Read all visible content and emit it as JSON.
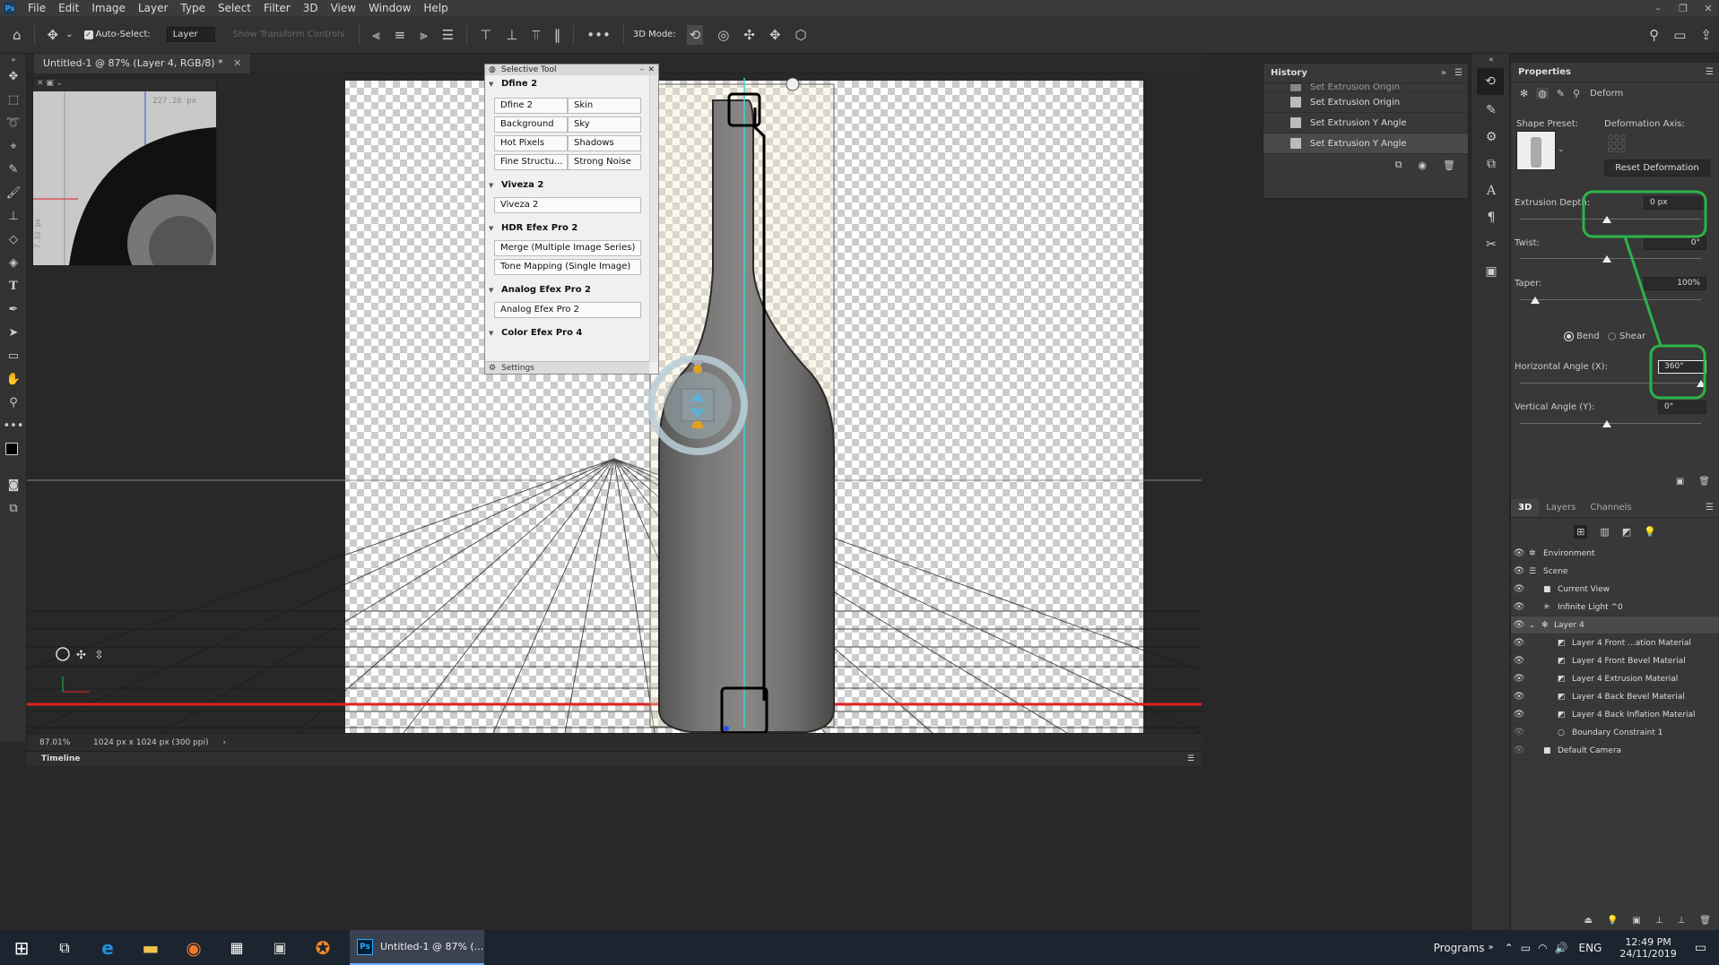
{
  "menu": [
    "File",
    "Edit",
    "Image",
    "Layer",
    "Type",
    "Select",
    "Filter",
    "3D",
    "View",
    "Window",
    "Help"
  ],
  "app_logo": "Ps",
  "options_bar": {
    "auto_select_label": "Auto-Select:",
    "auto_select_value": "Layer",
    "show_transform_label": "Show Transform Controls",
    "mode_label": "3D Mode:"
  },
  "document": {
    "tab_title": "Untitled-1 @ 87% (Layer 4, RGB/8) *",
    "zoom": "87.01%",
    "size_info": "1024 px x 1024 px (300 ppi)",
    "nav_label_top": "227.26 px",
    "nav_label_side": "7.32 px"
  },
  "timeline_label": "Timeline",
  "selective_tool": {
    "title": "Selective Tool",
    "groups": [
      {
        "name": "Dfine 2",
        "buttons": [
          "Dfine 2",
          "Skin",
          "Background",
          "Sky",
          "Hot Pixels",
          "Shadows",
          "Fine Structu...",
          "Strong Noise"
        ]
      },
      {
        "name": "Viveza 2",
        "buttons": [
          "Viveza 2"
        ]
      },
      {
        "name": "HDR Efex Pro 2",
        "buttons": [
          "Merge (Multiple Image Series)",
          "Tone Mapping (Single Image)"
        ]
      },
      {
        "name": "Analog Efex Pro 2",
        "buttons": [
          "Analog Efex Pro 2"
        ]
      },
      {
        "name": "Color Efex Pro 4",
        "buttons": []
      }
    ],
    "settings_label": "Settings"
  },
  "history": {
    "title": "History",
    "items": [
      "Set Extrusion Origin",
      "Set Extrusion Origin",
      "Set Extrusion Y Angle",
      "Set Extrusion Y Angle"
    ]
  },
  "properties": {
    "title": "Properties",
    "mode": "Deform",
    "shape_preset_label": "Shape Preset:",
    "deformation_axis_label": "Deformation Axis:",
    "reset_label": "Reset Deformation",
    "extrusion_depth_label": "Extrusion Depth:",
    "extrusion_depth_value": "0 px",
    "twist_label": "Twist:",
    "twist_value": "0°",
    "taper_label": "Taper:",
    "taper_value": "100%",
    "bend_label": "Bend",
    "shear_label": "Shear",
    "horizontal_angle_label": "Horizontal Angle (X):",
    "horizontal_angle_value": "360°",
    "vertical_angle_label": "Vertical Angle (Y):",
    "vertical_angle_value": "0°",
    "sliders": {
      "extrusion_depth": 0.5,
      "twist": 0.5,
      "taper": 0.1,
      "horizontal_angle": 1.0,
      "vertical_angle": 0.5
    }
  },
  "panel3d": {
    "tabs": [
      "3D",
      "Layers",
      "Channels"
    ],
    "items": [
      {
        "label": "Environment",
        "indent": 0
      },
      {
        "label": "Scene",
        "indent": 0
      },
      {
        "label": "Current View",
        "indent": 1
      },
      {
        "label": "Infinite Light ^0",
        "indent": 1
      },
      {
        "label": "Layer 4",
        "indent": 1
      },
      {
        "label": "Layer 4 Front ...ation Material",
        "indent": 2
      },
      {
        "label": "Layer 4 Front Bevel Material",
        "indent": 2
      },
      {
        "label": "Layer 4 Extrusion Material",
        "indent": 2
      },
      {
        "label": "Layer 4 Back Bevel Material",
        "indent": 2
      },
      {
        "label": "Layer 4 Back Inflation Material",
        "indent": 2
      },
      {
        "label": "Boundary Constraint 1",
        "indent": 2
      },
      {
        "label": "Default Camera",
        "indent": 1
      }
    ]
  },
  "taskbar": {
    "app_title": "Untitled-1 @ 87% (...",
    "app_icon": "Ps",
    "programs_label": "Programs",
    "lang": "ENG",
    "time": "12:49 PM",
    "date": "24/11/2019"
  },
  "colors": {
    "accent_green": "#2db34a",
    "guide_red": "#e02020",
    "guide_cyan": "#3fd4d4"
  }
}
